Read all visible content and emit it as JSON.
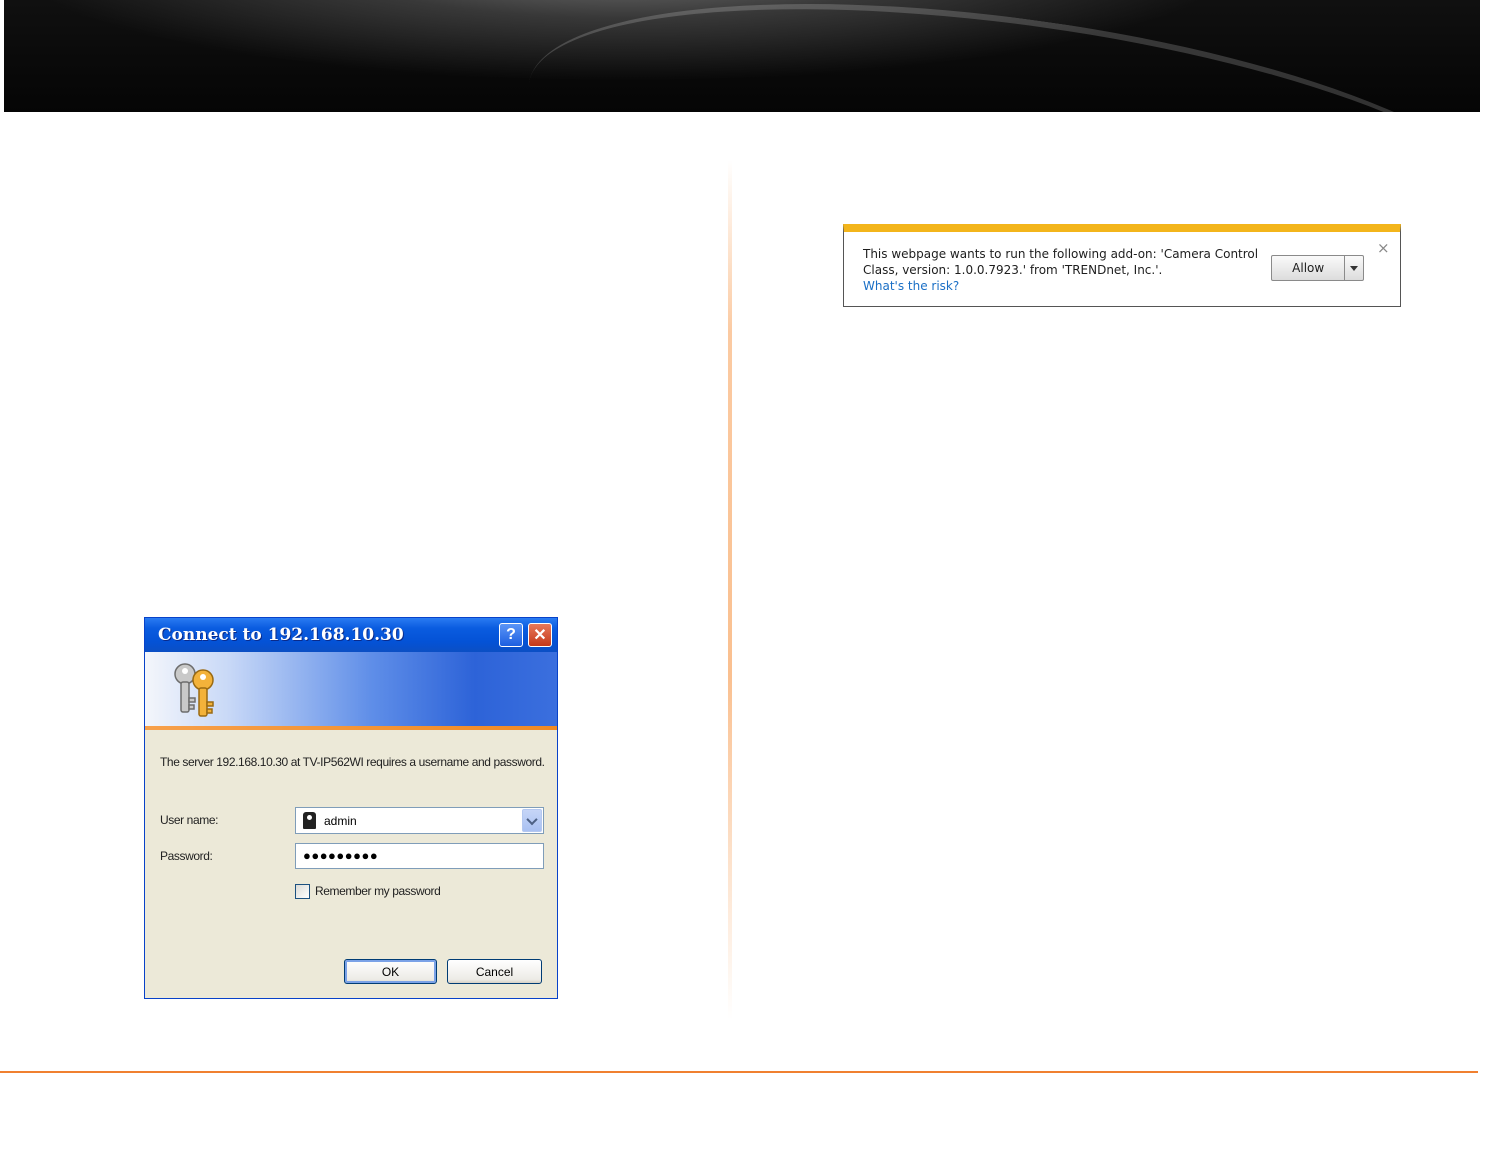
{
  "infobar": {
    "message": "This webpage wants to run the following add-on: 'Camera Control Class, version: 1.0.0.7923.' from 'TRENDnet, Inc.'.",
    "link": "What's the risk?",
    "allow_label": "Allow",
    "close_glyph": "×",
    "accent_color": "#f3b51b"
  },
  "login_dialog": {
    "title": "Connect to 192.168.10.30",
    "help_glyph": "?",
    "close_glyph": "✕",
    "message": "The server 192.168.10.30 at TV-IP562WI requires a username and password.",
    "user_label": "User name:",
    "user_value": "admin",
    "password_label": "Password:",
    "password_value": "●●●●●●●●●",
    "remember_label": "Remember my password",
    "ok_label": "OK",
    "cancel_label": "Cancel"
  },
  "colors": {
    "footer_rule": "#f08030",
    "divider": "#f79646"
  }
}
